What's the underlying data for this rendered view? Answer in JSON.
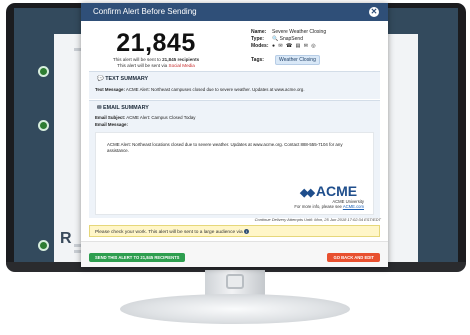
{
  "modal": {
    "title": "Confirm Alert Before Sending",
    "close_icon": "close-icon"
  },
  "summary": {
    "recipient_count": "21,845",
    "sent_prefix": "This alert will be sent to",
    "sent_count_text": "21,845 recipients",
    "via_prefix": "This alert will be sent via",
    "via_channel": "Social Media"
  },
  "meta": {
    "name_label": "Name:",
    "name_value": "Severe Weather Closing",
    "type_label": "Type:",
    "type_value": "🔍 SnapSend",
    "modes_label": "Modes:",
    "modes_icons": "● ✉ ☎ ▤ ✉ ◎",
    "tags_label": "Tags:",
    "tag": "Weather Closing"
  },
  "text_summary": {
    "heading": "TEXT SUMMARY",
    "icon": "chat-icon",
    "label": "Text Message:",
    "message": "ACME Alert: Northeast campuses closed due to severe weather. Updates at www.acme.org."
  },
  "email_summary": {
    "heading": "EMAIL SUMMARY",
    "icon": "mail-icon",
    "subject_label": "Email Subject:",
    "subject": "ACME Alert: Campus Closed Today",
    "message_label": "Email Message:",
    "body": "ACME Alert: Northeast locations closed due to severe weather. Updates at www.acme.org. Contact 888-555-7104 for any assistance.",
    "logo_text": "ACME",
    "logo_subtitle": "ACME University",
    "info_prefix": "For more info, please see",
    "info_link": "ACME.com"
  },
  "delivery_note": "Continue Delivery Attempts Until: Mon, 25 Jun 2018 17:02:34 EST/EDT",
  "warning": {
    "text": "Please check your work. This alert will be sent to a large audience via"
  },
  "footer": {
    "send_label": "SEND THIS ALERT TO 21,845 RECIPIENTS",
    "back_label": "GO BACK AND EDIT"
  },
  "background": {
    "heading_initial": "R"
  },
  "colors": {
    "header": "#2f4f78",
    "send": "#2e9e4f",
    "back": "#e8502f",
    "warning_bg": "#fff6c8",
    "section_bg": "#eef3f9",
    "social": "#c62828"
  }
}
